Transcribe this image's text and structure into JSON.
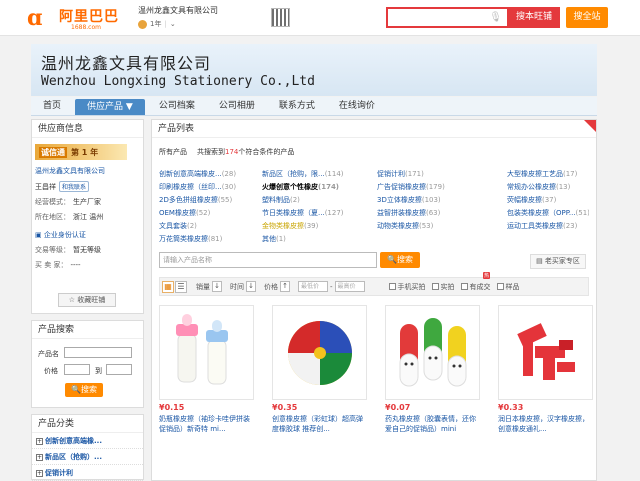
{
  "header": {
    "logo_cn": "阿里巴巴",
    "logo_url": "1688.com",
    "shop_name": "温州龙鑫文具有限公司",
    "shop_year": "1年",
    "search_placeholder": "",
    "search_button": "搜本旺铺",
    "search_all_button": "搜全站"
  },
  "banner": {
    "company_cn": "温州龙鑫文具有限公司",
    "company_en": "Wenzhou Longxing Stationery Co.,Ltd"
  },
  "nav": [
    "首页",
    "供应产品 ▼",
    "公司档案",
    "公司相册",
    "联系方式",
    "在线询价"
  ],
  "supplier": {
    "title": "供应商信息",
    "badge_text": "诚信通",
    "badge_year": "第 1 年",
    "company_link": "温州龙鑫文具有限公司",
    "contact_name": "王昌祥",
    "chat_label": "和我联系",
    "biz_label": "经营模式：",
    "biz_value": "生产厂家",
    "loc_label": "所在地区：",
    "loc_value": "浙江 温州",
    "cert": "企业身份认证",
    "trade_label": "交易等级：",
    "trade_value": "暂无等级",
    "credit_label": "买 卖 家：",
    "credit_value": "----",
    "fav_button": "收藏旺铺"
  },
  "product_search": {
    "title": "产品搜索",
    "name_label": "产品名",
    "price_label": "价格",
    "to_label": "到",
    "button": "搜索"
  },
  "categories": {
    "title": "产品分类",
    "items": [
      "创新创意高端橡...",
      "新品区（抢购）...",
      "促销计利"
    ]
  },
  "main": {
    "title": "产品列表",
    "tab_all": "所有产品",
    "found_prefix": "共搜索到",
    "found_count": "174",
    "found_suffix": "个符合条件的产品",
    "category_grid": [
      {
        "name": "创新创意高端橡皮...",
        "count": "(28)"
      },
      {
        "name": "新品区（抢购，限...",
        "count": "(114)"
      },
      {
        "name": "促销计利",
        "count": "(171)"
      },
      {
        "name": "大型橡皮擦工艺品",
        "count": "(17)"
      },
      {
        "name": "印刷橡皮擦（丝印...",
        "count": "(30)"
      },
      {
        "name": "火爆创意个性橡皮",
        "count": "(174)"
      },
      {
        "name": "广告促销橡皮擦",
        "count": "(179)"
      },
      {
        "name": "常规办公橡皮擦",
        "count": "(13)"
      },
      {
        "name": "2D多色拼组橡皮擦",
        "count": "(55)"
      },
      {
        "name": "塑料制品",
        "count": "(2)"
      },
      {
        "name": "3D立体橡皮擦",
        "count": "(103)"
      },
      {
        "name": "荧幅橡皮擦",
        "count": "(37)"
      },
      {
        "name": "OEM橡皮擦",
        "count": "(52)"
      },
      {
        "name": "节日类橡皮擦（夏...",
        "count": "(127)"
      },
      {
        "name": "益智拼装橡皮擦",
        "count": "(63)"
      },
      {
        "name": "包装类橡皮擦（OPP...",
        "count": "(51)"
      },
      {
        "name": "文具套装",
        "count": "(2)"
      },
      {
        "name": "金物类橡皮擦",
        "count": "(39)"
      },
      {
        "name": "动物类橡皮擦",
        "count": "(53)"
      },
      {
        "name": "运动工具类橡皮擦",
        "count": "(23)"
      },
      {
        "name": "万花筒类橡皮擦",
        "count": "(81)"
      },
      {
        "name": "其他",
        "count": "(1)"
      }
    ],
    "keyword_placeholder": "请输入产品名称",
    "keyword_button": "搜索",
    "old_buyer": "老买家专区",
    "sort": {
      "sales": "销量",
      "time": "时间",
      "price": "价格",
      "from": "最低价",
      "to": "最高价",
      "mobile": "手机买拍",
      "real": "实拍",
      "stock": "有成交",
      "sample": "样品",
      "hot": "热"
    },
    "products": [
      {
        "price": "¥0.15",
        "desc": "奶瓶橡皮擦（袖珍卡哇伊拼装促销品）新奇特 mi..."
      },
      {
        "price": "¥0.35",
        "desc": "创意橡皮擦（彩虹球）超高弹度橡胶球 推荐创..."
      },
      {
        "price": "¥0.07",
        "desc": "药丸橡皮擦（胶囊表情，还你爱自己的促销品）mini"
      },
      {
        "price": "¥0.33",
        "desc": "润日本橡皮擦，汉字橡皮擦，创意橡皮通礼..."
      }
    ]
  }
}
